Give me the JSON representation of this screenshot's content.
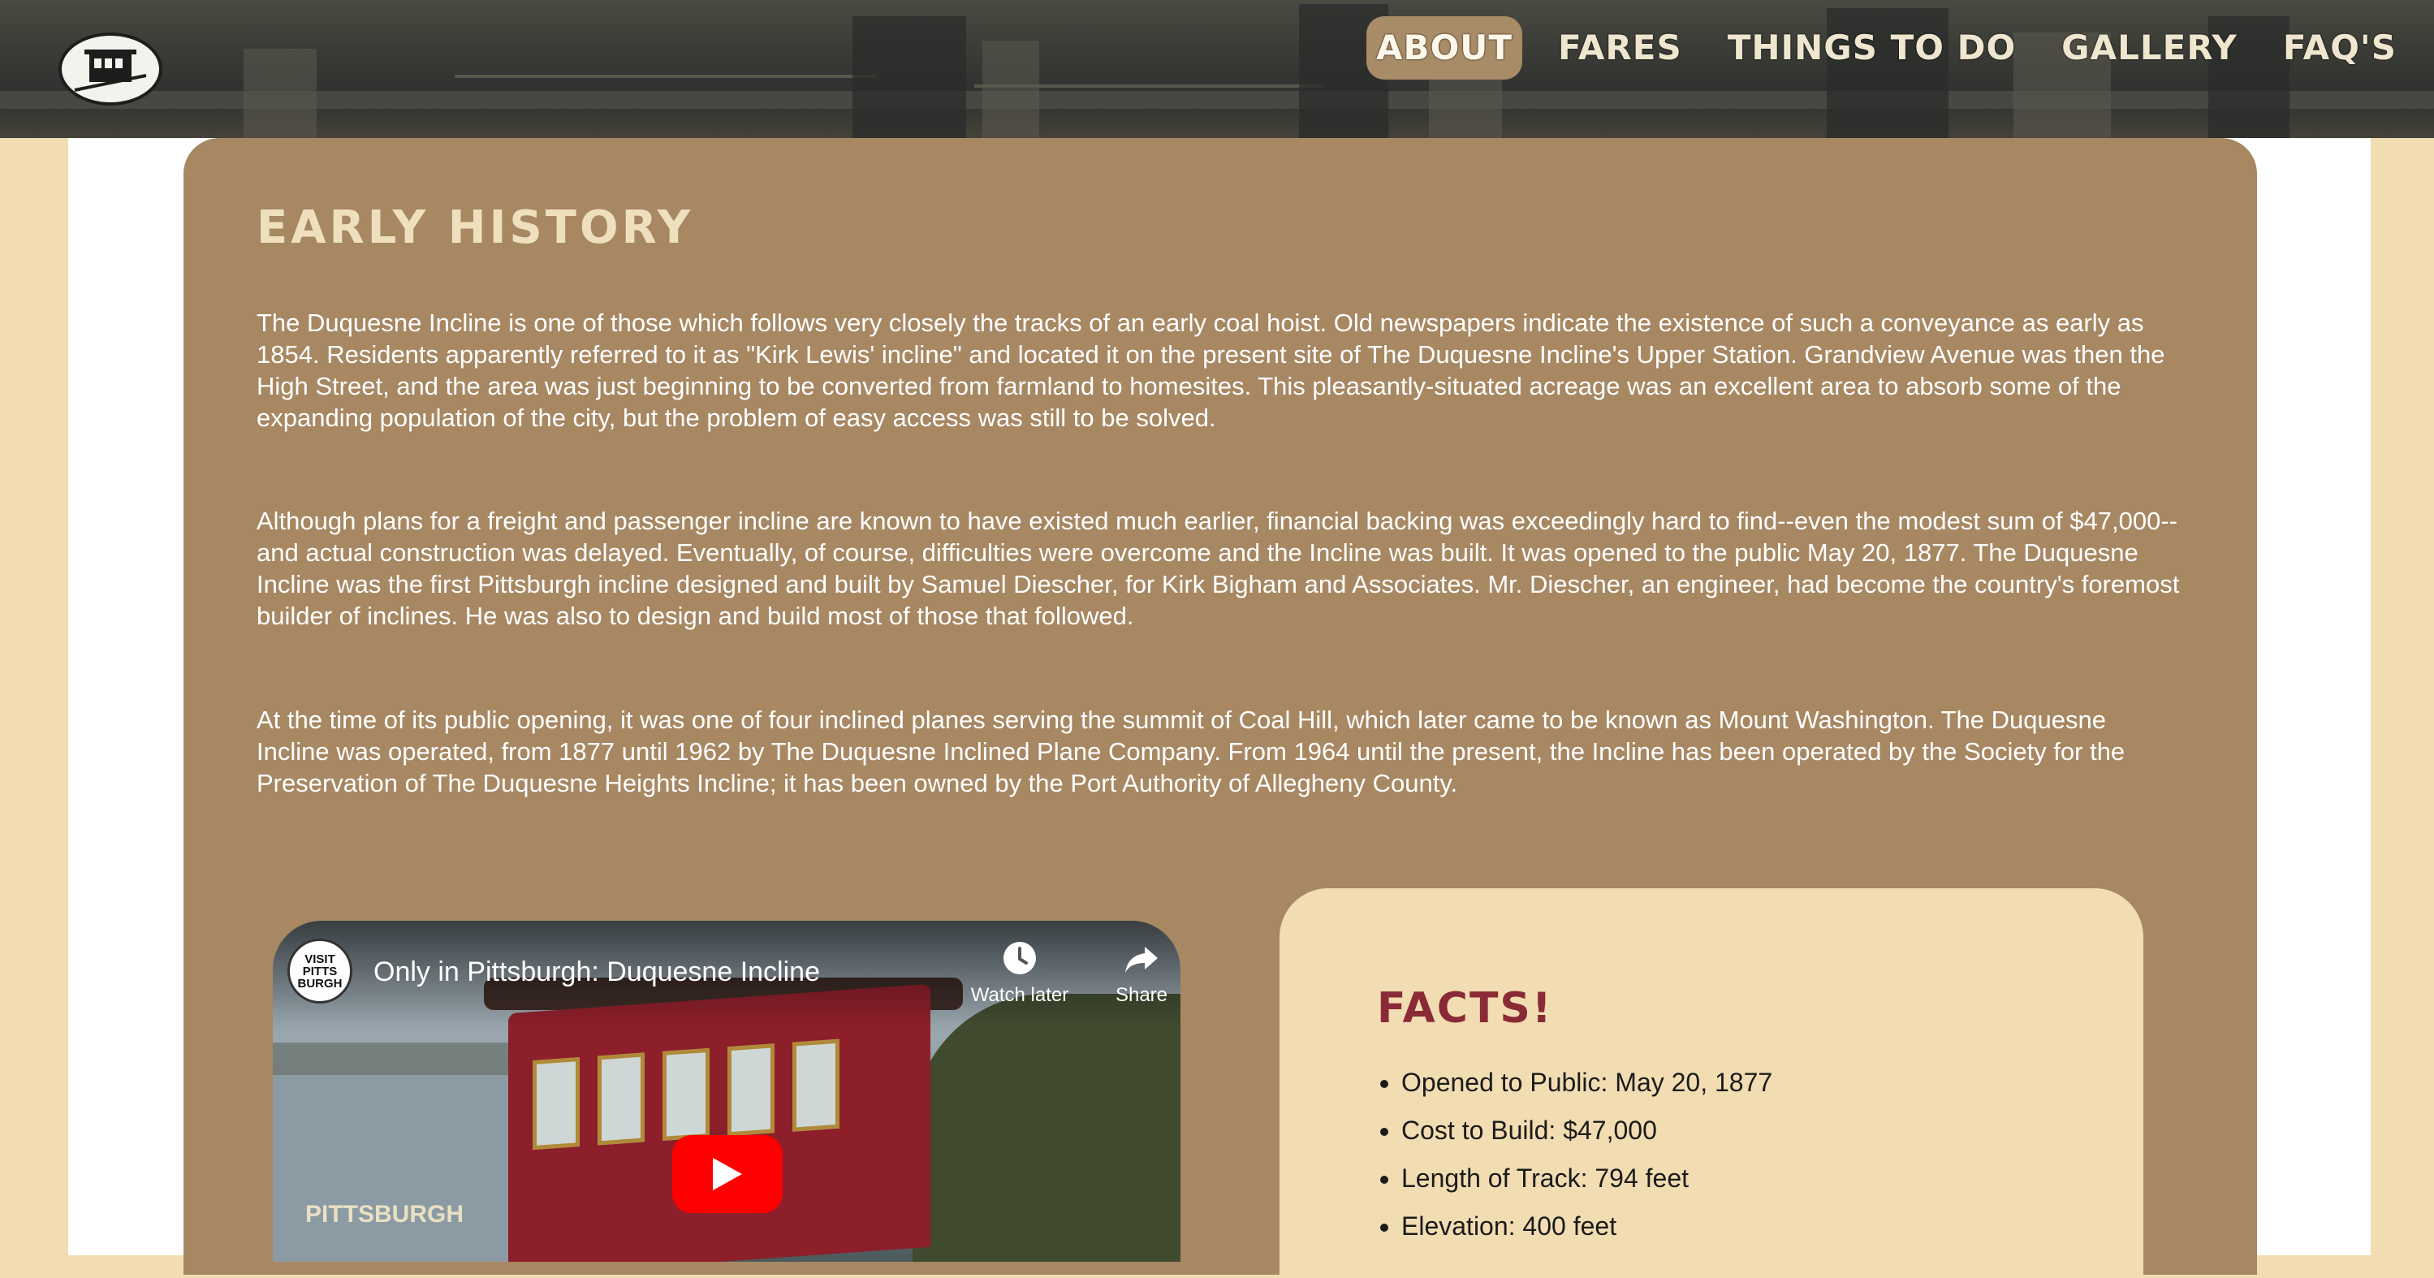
{
  "header": {
    "nav": [
      "ABOUT",
      "FARES",
      "THINGS TO DO",
      "GALLERY",
      "FAQ'S"
    ],
    "active": "ABOUT"
  },
  "main": {
    "title": "EARLY HISTORY",
    "paragraphs": [
      "The Duquesne Incline is one of those which follows very closely the tracks of an early coal hoist. Old newspapers indicate the existence of such a conveyance as early as 1854. Residents apparently referred to it as \"Kirk Lewis' incline\" and located it on the present site of The Duquesne Incline's Upper Station. Grandview Avenue was then the High Street, and the area was just beginning to be converted from farmland to homesites. This pleasantly-situated acreage was an excellent area to absorb some of the expanding population of the city, but the problem of easy access was still to be solved.",
      "Although plans for a freight and passenger incline are known to have existed much earlier, financial backing was exceedingly hard to find--even the modest sum of $47,000--and actual construction was delayed. Eventually, of course, difficulties were overcome and the Incline was built. It was opened to the public May 20, 1877. The Duquesne Incline was the first Pittsburgh incline designed and built by Samuel Diescher, for Kirk Bigham and Associates. Mr. Diescher, an engineer, had become the country's foremost builder of inclines. He was also to design and build most of those that followed.",
      "At the time of its public opening, it was one of four inclined planes serving the summit of Coal Hill, which later came to be known as Mount Washington. The Duquesne Incline was operated, from 1877 until 1962 by The Duquesne Inclined Plane Company. From 1964 until the present, the Incline has been operated by the Society for the Preservation of The Duquesne Heights Incline; it has been owned by the Port Authority of Allegheny County."
    ]
  },
  "video": {
    "title": "Only in Pittsburgh: Duquesne Incline",
    "channel_lines": [
      "VISIT",
      "PITTS",
      "BURGH"
    ],
    "watch_later": "Watch later",
    "share": "Share",
    "brand": "PITTSBURGH"
  },
  "facts": {
    "title": "FACTS!",
    "items": [
      "Opened to Public: May 20, 1877",
      "Cost to Build: $47,000",
      "Length of Track: 794 feet",
      "Elevation: 400 feet"
    ]
  },
  "colors": {
    "card": "#a78863",
    "cream": "#f1ddb1",
    "facts_title": "#8a2a37",
    "nav_active": "#a88b67"
  },
  "icons": [
    "incline-logo-icon",
    "clock-icon",
    "share-icon",
    "play-icon"
  ]
}
